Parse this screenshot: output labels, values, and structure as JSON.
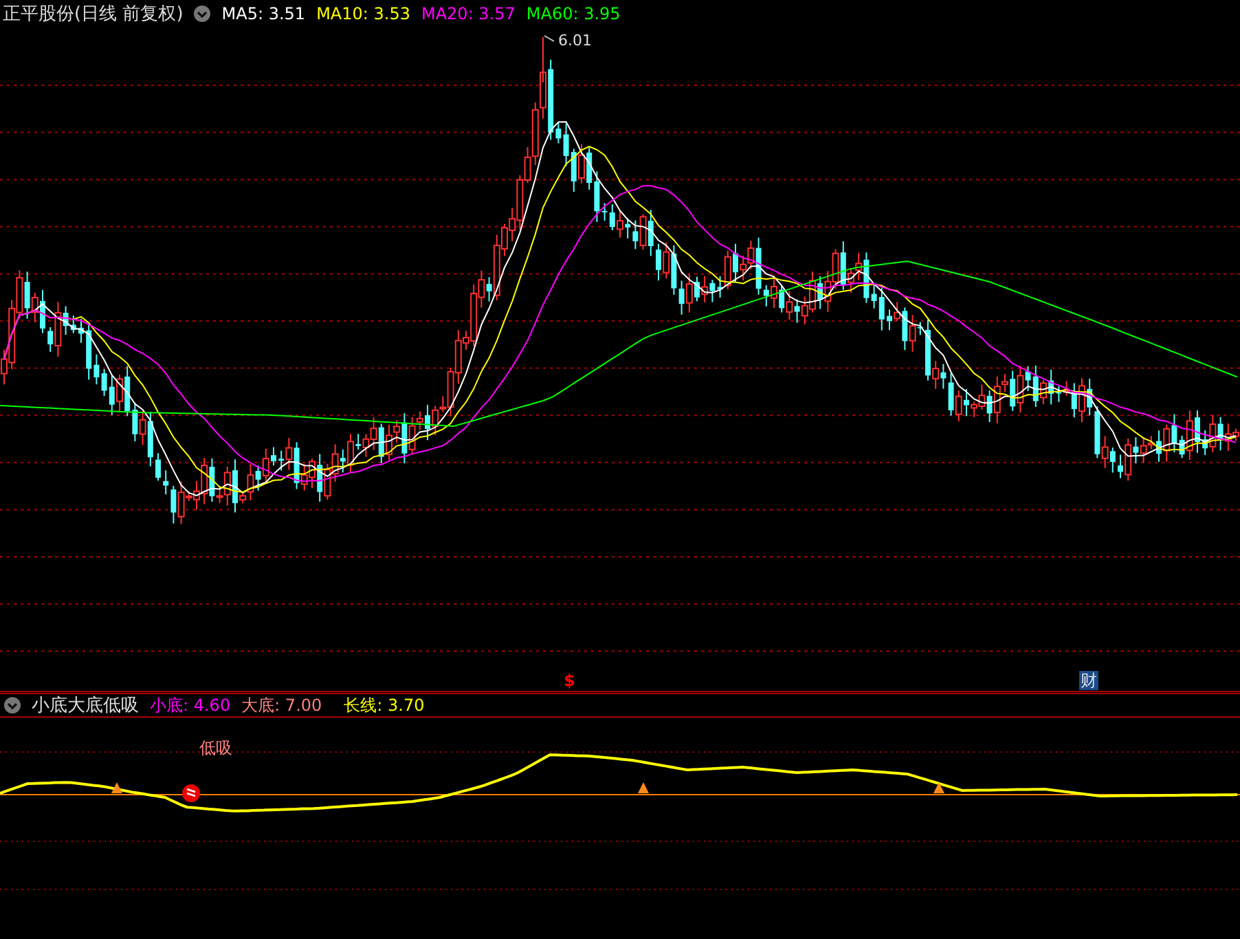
{
  "main_panel": {
    "title": "正平股份(日线 前复权)",
    "indicators": [
      {
        "label": "MA5: 3.51",
        "color": "#ffffff"
      },
      {
        "label": "MA10: 3.53",
        "color": "#ffff00"
      },
      {
        "label": "MA20: 3.57",
        "color": "#ff00ff"
      },
      {
        "label": "MA60: 3.95",
        "color": "#00ff00"
      }
    ],
    "peak_label": "6.01",
    "markers": [
      {
        "kind": "dollar",
        "text": "$"
      },
      {
        "kind": "finance",
        "text": "财"
      }
    ]
  },
  "sub_panel": {
    "title": "小底大底低吸",
    "indicators": [
      {
        "label": "小底: 4.60",
        "color": "#ff00ff"
      },
      {
        "label": "大底: 7.00",
        "color": "#ff8080"
      },
      {
        "label": "长线: 3.70",
        "color": "#ffff00"
      }
    ],
    "signal_label": "低吸"
  }
}
